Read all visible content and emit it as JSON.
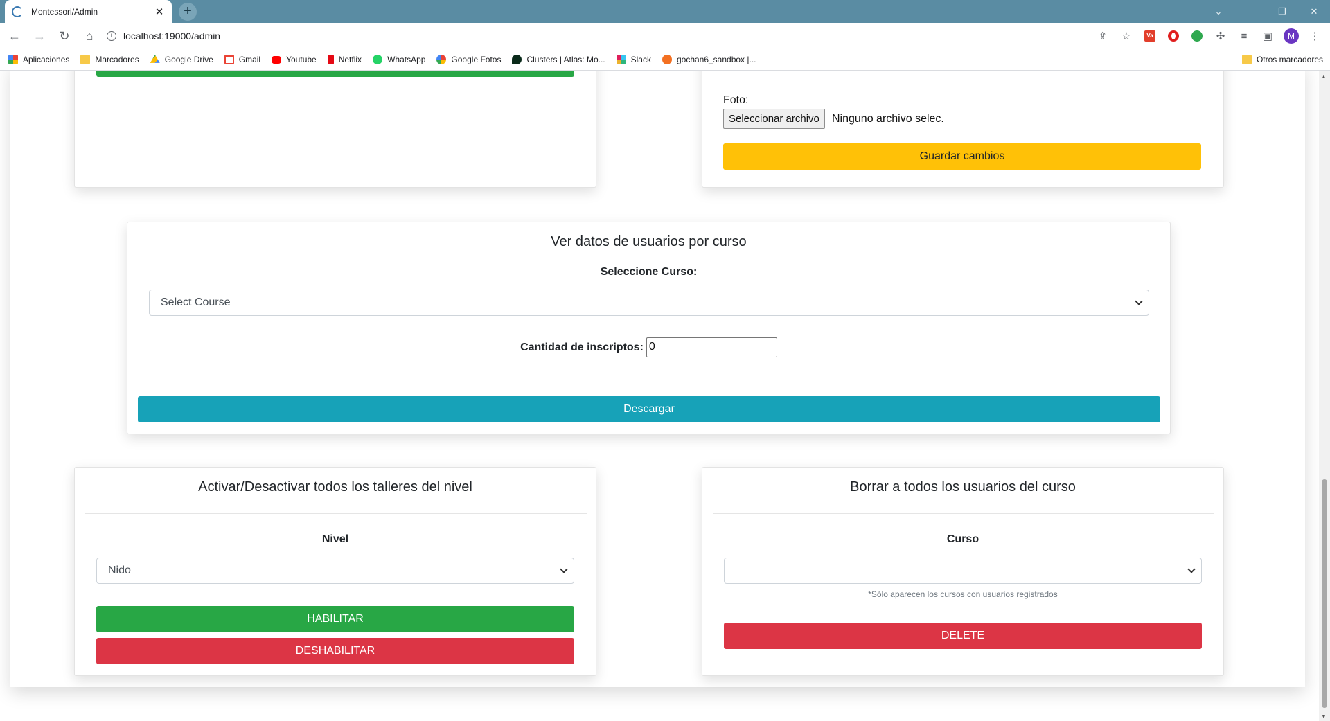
{
  "browser": {
    "tab_title": "Montessori/Admin",
    "tab_close": "✕",
    "new_tab": "+",
    "url": "localhost:19000/admin",
    "avatar_initial": "M",
    "ext_label": "Va",
    "bookmarks": [
      {
        "label": "Aplicaciones",
        "icon": "apps-icon"
      },
      {
        "label": "Marcadores",
        "icon": "folder-icon"
      },
      {
        "label": "Google Drive",
        "icon": "google-drive-icon"
      },
      {
        "label": "Gmail",
        "icon": "gmail-icon"
      },
      {
        "label": "Youtube",
        "icon": "youtube-icon"
      },
      {
        "label": "Netflix",
        "icon": "netflix-icon"
      },
      {
        "label": "WhatsApp",
        "icon": "whatsapp-icon"
      },
      {
        "label": "Google Fotos",
        "icon": "google-photos-icon"
      },
      {
        "label": "Clusters | Atlas: Mo...",
        "icon": "mongodb-atlas-icon"
      },
      {
        "label": "Slack",
        "icon": "slack-icon"
      },
      {
        "label": "gochan6_sandbox |...",
        "icon": "cp-icon"
      }
    ],
    "other_bookmarks": "Otros marcadores"
  },
  "photo_card": {
    "foto_label": "Foto:",
    "file_button": "Seleccionar archivo",
    "file_status": "Ninguno archivo selec.",
    "save_button": "Guardar cambios"
  },
  "users_by_course": {
    "title": "Ver datos de usuarios por curso",
    "select_label": "Seleccione Curso:",
    "select_value": "Select Course",
    "count_label": "Cantidad de inscriptos:",
    "count_value": "0",
    "download_button": "Descargar"
  },
  "workshops_card": {
    "title": "Activar/Desactivar todos los talleres del nivel",
    "level_label": "Nivel",
    "level_value": "Nido",
    "enable_button": "HABILITAR",
    "disable_button": "DESHABILITAR"
  },
  "delete_card": {
    "title": "Borrar a todos los usuarios del curso",
    "course_label": "Curso",
    "course_value": "",
    "note": "*Sólo aparecen los cursos con usuarios registrados",
    "delete_button": "DELETE"
  },
  "colors": {
    "green": "#28a745",
    "red": "#dc3545",
    "teal": "#17a2b8",
    "yellow": "#ffc107",
    "tabstrip": "#5a8ca3"
  }
}
